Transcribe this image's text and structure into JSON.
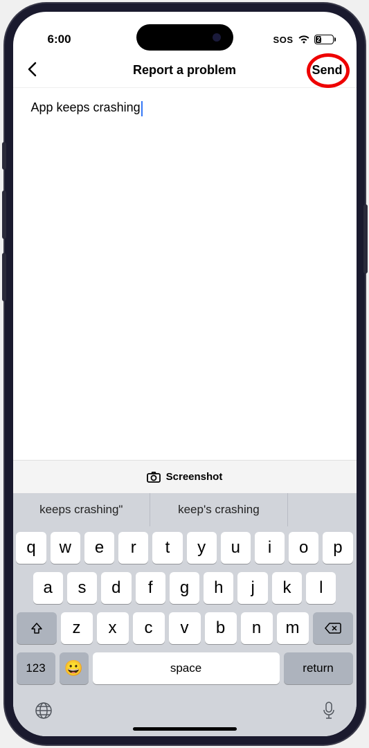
{
  "status": {
    "time": "6:00",
    "sos": "SOS",
    "battery_pct": "27",
    "battery_fill_pct": 27
  },
  "nav": {
    "title": "Report a problem",
    "send_label": "Send"
  },
  "content": {
    "text_value": "App keeps crashing"
  },
  "screenshot": {
    "label": "Screenshot"
  },
  "suggestions": [
    "keeps crashing\"",
    "keep's crashing",
    ""
  ],
  "keyboard": {
    "row1": [
      "q",
      "w",
      "e",
      "r",
      "t",
      "y",
      "u",
      "i",
      "o",
      "p"
    ],
    "row2": [
      "a",
      "s",
      "d",
      "f",
      "g",
      "h",
      "j",
      "k",
      "l"
    ],
    "row3": [
      "z",
      "x",
      "c",
      "v",
      "b",
      "n",
      "m"
    ],
    "numbers_label": "123",
    "space_label": "space",
    "return_label": "return"
  }
}
